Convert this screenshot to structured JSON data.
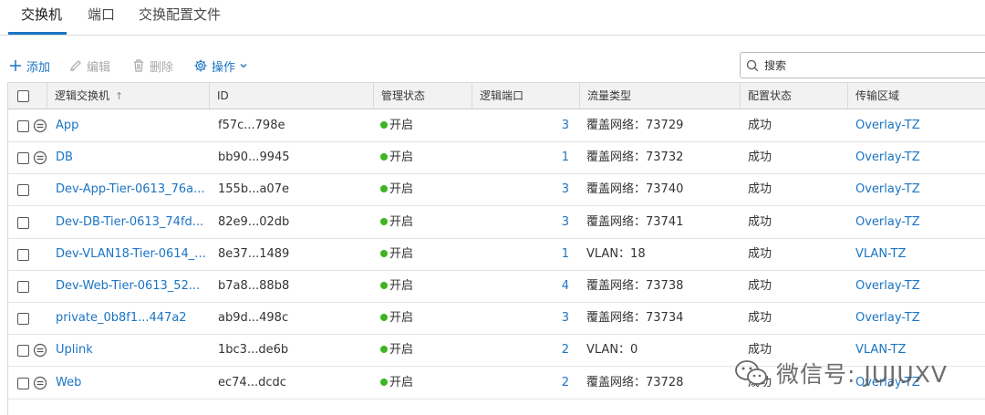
{
  "tabs": [
    {
      "label": "交换机",
      "active": true
    },
    {
      "label": "端口",
      "active": false
    },
    {
      "label": "交换配置文件",
      "active": false
    }
  ],
  "toolbar": {
    "add": "添加",
    "edit": "编辑",
    "delete": "删除",
    "actions": "操作"
  },
  "search": {
    "placeholder": "搜索"
  },
  "columns": {
    "name": "逻辑交换机",
    "id": "ID",
    "admin_state": "管理状态",
    "ports": "逻辑端口",
    "traffic_type": "流量类型",
    "config_state": "配置状态",
    "transport_zone": "传输区域"
  },
  "rows": [
    {
      "name": "App",
      "id": "f57c...798e",
      "admin_state": "开启",
      "ports": "3",
      "traffic_type": "覆盖网络：73729",
      "config_state": "成功",
      "transport_zone": "Overlay-TZ",
      "icon": true
    },
    {
      "name": "DB",
      "id": "bb90...9945",
      "admin_state": "开启",
      "ports": "1",
      "traffic_type": "覆盖网络：73732",
      "config_state": "成功",
      "transport_zone": "Overlay-TZ",
      "icon": true
    },
    {
      "name": "Dev-App-Tier-0613_76a...",
      "id": "155b...a07e",
      "admin_state": "开启",
      "ports": "3",
      "traffic_type": "覆盖网络：73740",
      "config_state": "成功",
      "transport_zone": "Overlay-TZ",
      "icon": false
    },
    {
      "name": "Dev-DB-Tier-0613_74fd...",
      "id": "82e9...02db",
      "admin_state": "开启",
      "ports": "3",
      "traffic_type": "覆盖网络：73741",
      "config_state": "成功",
      "transport_zone": "Overlay-TZ",
      "icon": false
    },
    {
      "name": "Dev-VLAN18-Tier-0614_...",
      "id": "8e37...1489",
      "admin_state": "开启",
      "ports": "1",
      "traffic_type": "VLAN：18",
      "config_state": "成功",
      "transport_zone": "VLAN-TZ",
      "icon": false
    },
    {
      "name": "Dev-Web-Tier-0613_52...",
      "id": "b7a8...88b8",
      "admin_state": "开启",
      "ports": "4",
      "traffic_type": "覆盖网络：73738",
      "config_state": "成功",
      "transport_zone": "Overlay-TZ",
      "icon": false
    },
    {
      "name": "private_0b8f1...447a2",
      "id": "ab9d...498c",
      "admin_state": "开启",
      "ports": "3",
      "traffic_type": "覆盖网络：73734",
      "config_state": "成功",
      "transport_zone": "Overlay-TZ",
      "icon": false
    },
    {
      "name": "Uplink",
      "id": "1bc3...de6b",
      "admin_state": "开启",
      "ports": "2",
      "traffic_type": "VLAN：0",
      "config_state": "成功",
      "transport_zone": "VLAN-TZ",
      "icon": true
    },
    {
      "name": "Web",
      "id": "ec74...dcdc",
      "admin_state": "开启",
      "ports": "2",
      "traffic_type": "覆盖网络：73728",
      "config_state": "成功",
      "transport_zone": "Overlay-TZ",
      "icon": true
    }
  ],
  "watermark": {
    "text": "微信号: JUJUXV",
    "icon": "wechat-icon"
  },
  "colors": {
    "accent": "#1b74c4",
    "status_on": "#3cb521"
  },
  "icons": {
    "add": "plus-icon",
    "edit": "pencil-icon",
    "delete": "trash-icon",
    "actions": "gear-icon",
    "search": "search-icon",
    "row": "logical-switch-icon"
  }
}
